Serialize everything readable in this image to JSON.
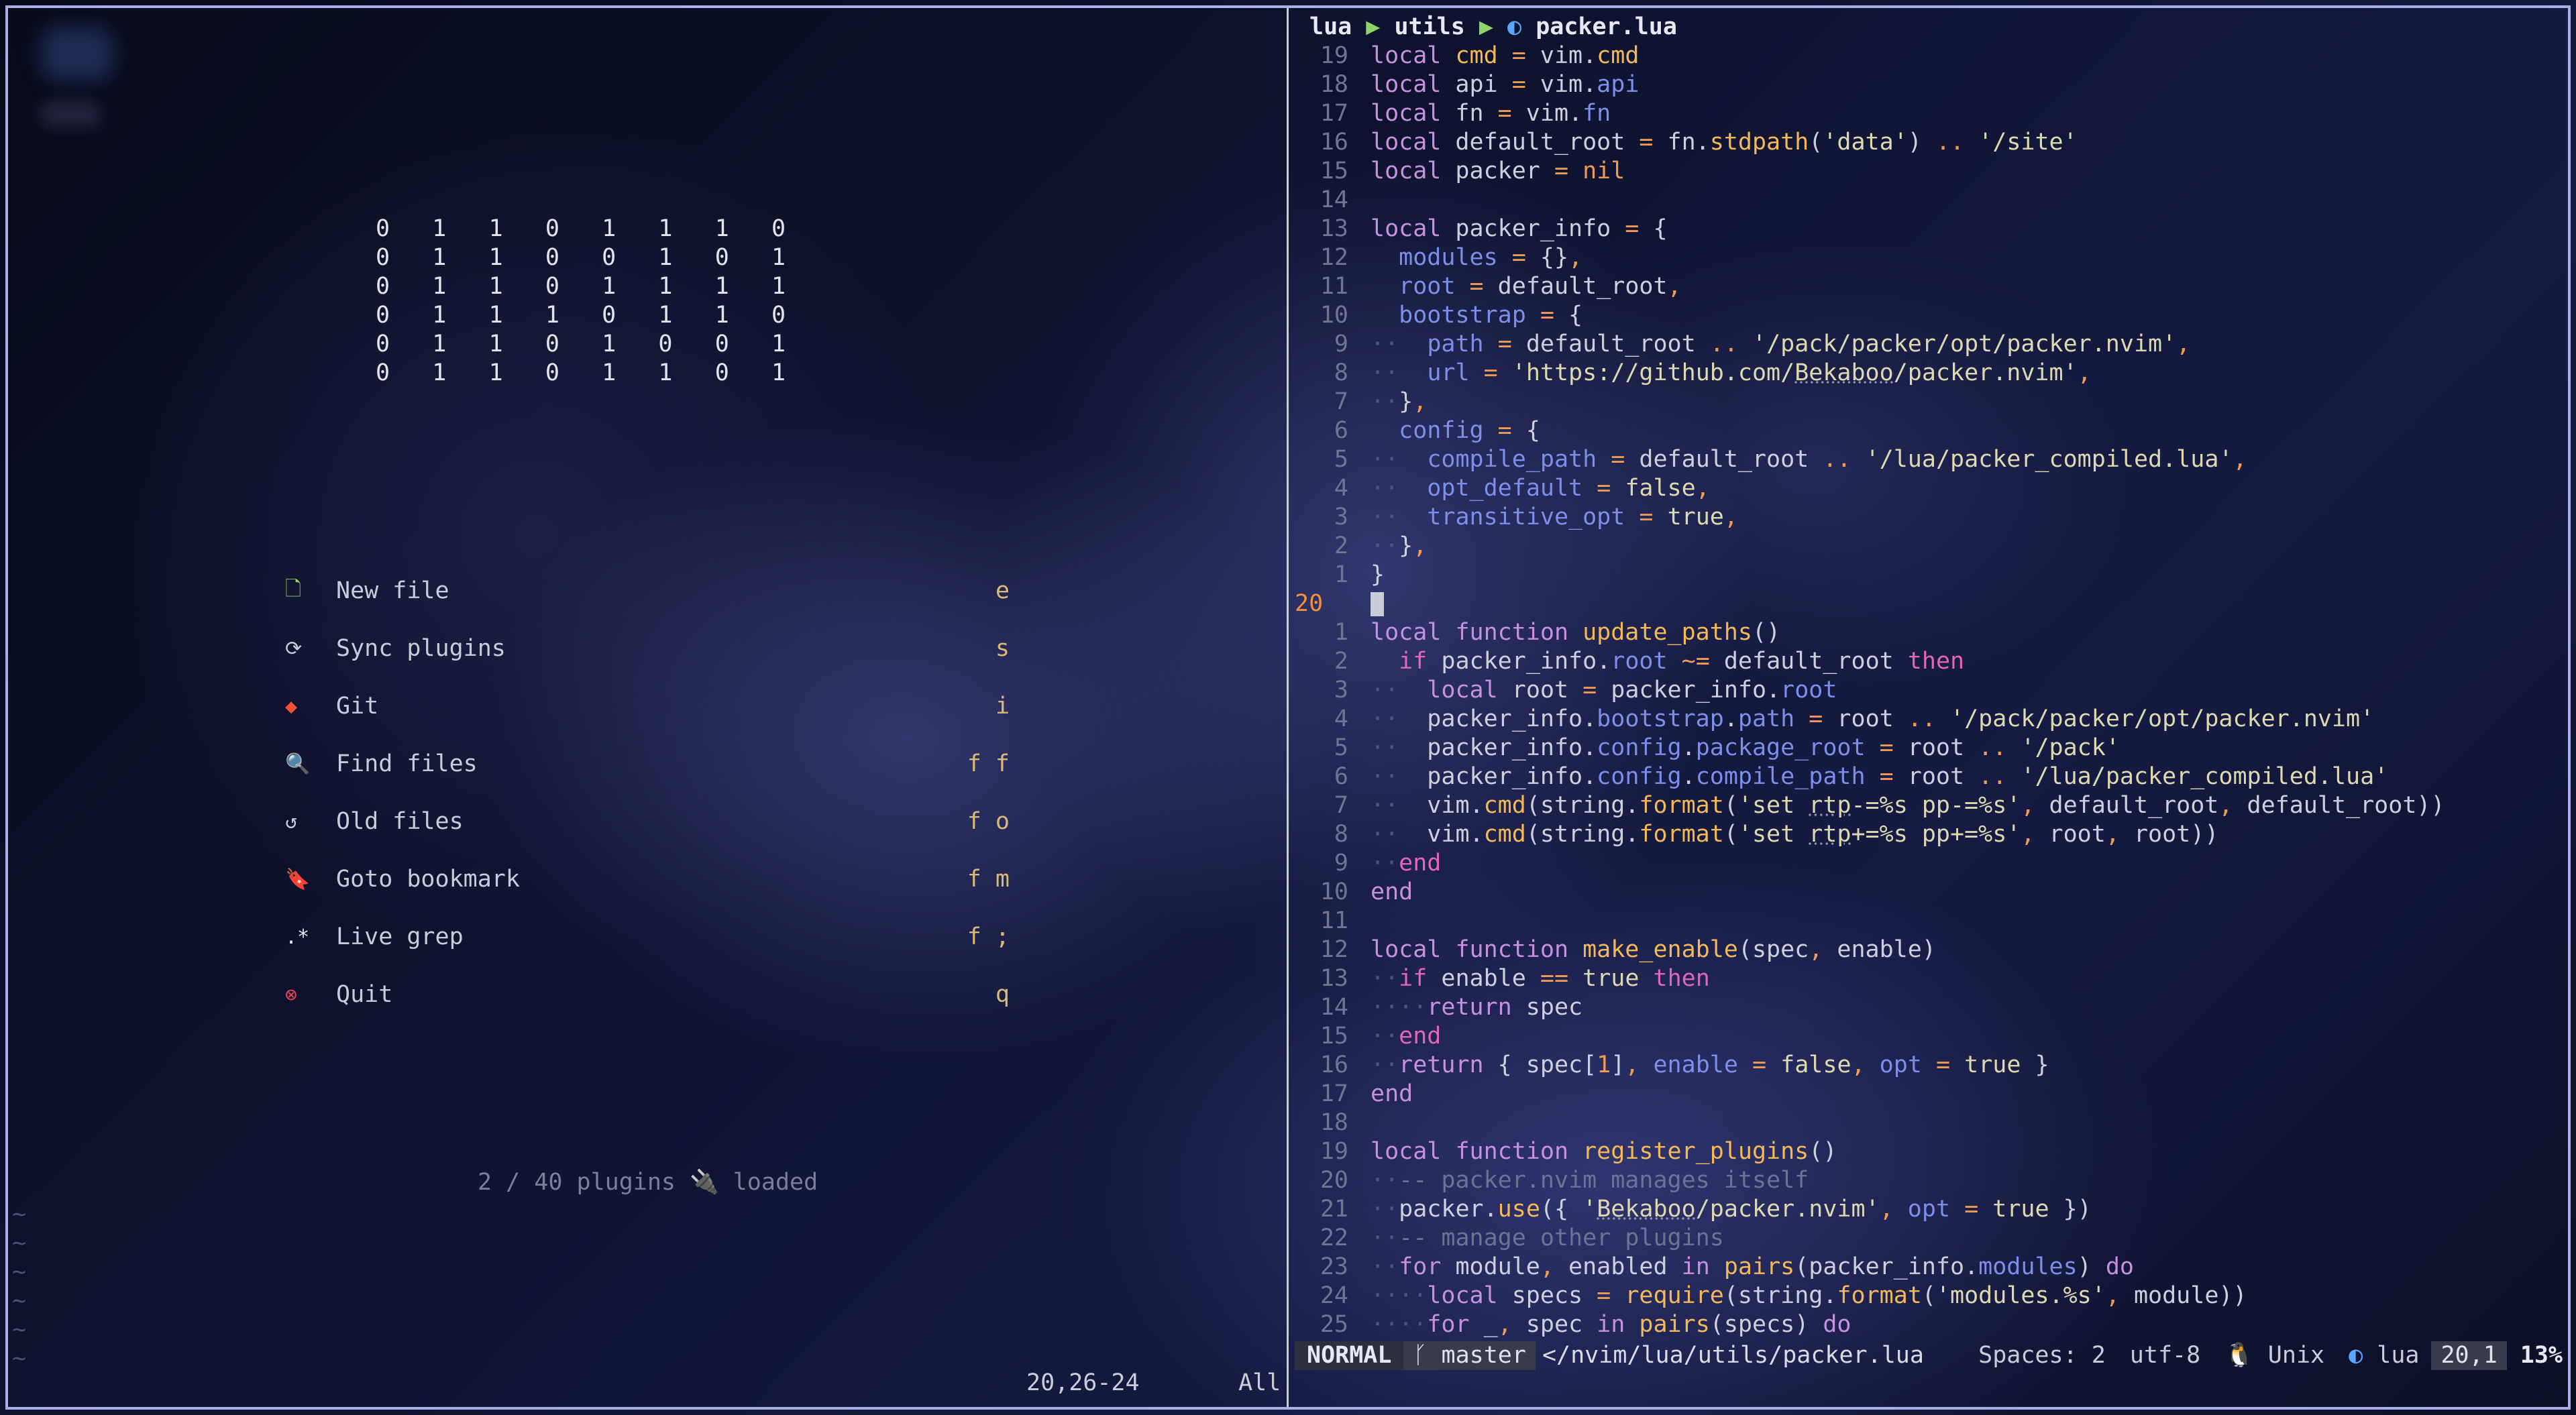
{
  "dashboard": {
    "binary_rows": [
      "0   1   1   0   1   1   1   0",
      "0   1   1   0   0   1   0   1",
      "0   1   1   0   1   1   1   1",
      "0   1   1   1   0   1   1   0",
      "0   1   1   0   1   0   0   1",
      "0   1   1   0   1   1   0   1"
    ],
    "menu": [
      {
        "icon": "new-file-icon",
        "glyph": "🗋",
        "color": "#9ad06a",
        "label": "New file",
        "key": "e"
      },
      {
        "icon": "sync-icon",
        "glyph": "⟳",
        "color": "#c8ccd8",
        "label": "Sync plugins",
        "key": "s"
      },
      {
        "icon": "git-icon",
        "glyph": "◆",
        "color": "#f05133",
        "label": "Git",
        "key": "i"
      },
      {
        "icon": "find-files-icon",
        "glyph": "🔍",
        "color": "#7fb2e8",
        "label": "Find files",
        "key": "f f"
      },
      {
        "icon": "history-icon",
        "glyph": "↺",
        "color": "#c8ccd8",
        "label": "Old files",
        "key": "f o"
      },
      {
        "icon": "bookmark-icon",
        "glyph": "🔖",
        "color": "#f2b85a",
        "label": "Goto bookmark",
        "key": "f m"
      },
      {
        "icon": "regex-icon",
        "glyph": ".*",
        "color": "#e8e8f2",
        "label": "Live grep",
        "key": "f ;"
      },
      {
        "icon": "quit-icon",
        "glyph": "⊗",
        "color": "#e0445a",
        "label": "Quit",
        "key": "q"
      }
    ],
    "plugins_loaded": "2 / 40  plugins 🔌 loaded",
    "tildes": "~\n~\n~\n~\n~\n~",
    "ruler": "20,26-24       All"
  },
  "winbar": {
    "dir1": "lua",
    "dir2": "utils",
    "file": "packer.lua",
    "sep": "▶",
    "file_icon": "lua-icon"
  },
  "code_lines": [
    {
      "n": "19",
      "h": "<span class='kw'>local</span> <span class='fn'>cmd</span> <span class='op'>=</span> vim.<span class='fn'>cmd</span>"
    },
    {
      "n": "18",
      "h": "<span class='kw'>local</span> api <span class='op'>=</span> vim.<span class='var'>api</span>"
    },
    {
      "n": "17",
      "h": "<span class='kw'>local</span> fn <span class='op'>=</span> vim.<span class='var'>fn</span>"
    },
    {
      "n": "16",
      "h": "<span class='kw'>local</span> default_root <span class='op'>=</span> fn.<span class='fn'>stdpath</span>(<span class='str'>'data'</span>) <span class='op'>..</span> <span class='str'>'/site'</span>"
    },
    {
      "n": "15",
      "h": "<span class='kw'>local</span> packer <span class='op'>=</span> <span class='op'>nil</span>"
    },
    {
      "n": "14",
      "h": ""
    },
    {
      "n": "13",
      "h": "<span class='kw'>local</span> packer_info <span class='op'>=</span> {"
    },
    {
      "n": "12",
      "h": "  <span class='var'>modules</span> <span class='op'>=</span> {}<span class='op'>,</span>"
    },
    {
      "n": "11",
      "h": "  <span class='var'>root</span> <span class='op'>=</span> default_root<span class='op'>,</span>"
    },
    {
      "n": "10",
      "h": "  <span class='var'>bootstrap</span> <span class='op'>=</span> {"
    },
    {
      "n": "9",
      "h": "<span class='dot'>··</span>  <span class='var'>path</span> <span class='op'>=</span> default_root <span class='op'>..</span> <span class='str'>'/pack/packer/opt/packer.nvim'</span><span class='op'>,</span>"
    },
    {
      "n": "8",
      "h": "<span class='dot'>··</span>  <span class='var'>url</span> <span class='op'>=</span> <span class='str'>'https://github.com/<span class=\"ul\">Bekaboo</span>/packer.nvim'</span><span class='op'>,</span>"
    },
    {
      "n": "7",
      "h": "<span class='dot'>··</span>}<span class='op'>,</span>"
    },
    {
      "n": "6",
      "h": "  <span class='var'>config</span> <span class='op'>=</span> {"
    },
    {
      "n": "5",
      "h": "<span class='dot'>··</span>  <span class='var'>compile_path</span> <span class='op'>=</span> default_root <span class='op'>..</span> <span class='str'>'/lua/packer_compiled.lua'</span><span class='op'>,</span>"
    },
    {
      "n": "4",
      "h": "<span class='dot'>··</span>  <span class='var'>opt_default</span> <span class='op'>=</span> <span class='str'>false</span><span class='op'>,</span>"
    },
    {
      "n": "3",
      "h": "<span class='dot'>··</span>  <span class='var'>transitive_opt</span> <span class='op'>=</span> <span class='str'>true</span><span class='op'>,</span>"
    },
    {
      "n": "2",
      "h": "<span class='dot'>··</span>}<span class='op'>,</span>"
    },
    {
      "n": "1",
      "h": "}"
    },
    {
      "n": "20",
      "cur": true,
      "h": "<span class='cursor'></span>"
    },
    {
      "n": "1",
      "h": "<span class='kw'>local</span> <span class='kw'>function</span> <span class='fn'>update_paths</span>()"
    },
    {
      "n": "2",
      "h": "  <span class='kw2'>if</span> packer_info.<span class='var'>root</span> <span class='op'>~=</span> default_root <span class='kw2'>then</span>"
    },
    {
      "n": "3",
      "h": "<span class='dot'>··</span>  <span class='kw'>local</span> root <span class='op'>=</span> packer_info.<span class='var'>root</span>"
    },
    {
      "n": "4",
      "h": "<span class='dot'>··</span>  packer_info.<span class='var'>bootstrap</span>.<span class='var'>path</span> <span class='op'>=</span> root <span class='op'>..</span> <span class='str'>'/pack/packer/opt/packer.nvim'</span>"
    },
    {
      "n": "5",
      "h": "<span class='dot'>··</span>  packer_info.<span class='var'>config</span>.<span class='var'>package_root</span> <span class='op'>=</span> root <span class='op'>..</span> <span class='str'>'/pack'</span>"
    },
    {
      "n": "6",
      "h": "<span class='dot'>··</span>  packer_info.<span class='var'>config</span>.<span class='var'>compile_path</span> <span class='op'>=</span> root <span class='op'>..</span> <span class='str'>'/lua/packer_compiled.lua'</span>"
    },
    {
      "n": "7",
      "h": "<span class='dot'>··</span>  vim.<span class='fn'>cmd</span>(string.<span class='fn'>format</span>(<span class='str'>'set <span class=\"ul\">rtp</span>-=%s pp-=%s'</span><span class='op'>,</span> default_root<span class='op'>,</span> default_root))"
    },
    {
      "n": "8",
      "h": "<span class='dot'>··</span>  vim.<span class='fn'>cmd</span>(string.<span class='fn'>format</span>(<span class='str'>'set <span class=\"ul\">rtp</span>+=%s pp+=%s'</span><span class='op'>,</span> root<span class='op'>,</span> root))"
    },
    {
      "n": "9",
      "h": "<span class='dot'>··</span><span class='kw2'>end</span>"
    },
    {
      "n": "10",
      "h": "<span class='kw'>end</span>"
    },
    {
      "n": "11",
      "h": ""
    },
    {
      "n": "12",
      "h": "<span class='kw'>local</span> <span class='kw'>function</span> <span class='fn'>make_enable</span>(spec<span class='op'>,</span> enable)"
    },
    {
      "n": "13",
      "h": "<span class='dot'>··</span><span class='kw2'>if</span> enable <span class='op'>==</span> <span class='str'>true</span> <span class='kw2'>then</span>"
    },
    {
      "n": "14",
      "h": "<span class='dot'>····</span><span class='kw'>return</span> spec"
    },
    {
      "n": "15",
      "h": "<span class='dot'>··</span><span class='kw2'>end</span>"
    },
    {
      "n": "16",
      "h": "<span class='dot'>··</span><span class='kw'>return</span> { spec[<span class='op'>1</span>]<span class='op'>,</span> <span class='var'>enable</span> <span class='op'>=</span> <span class='str'>false</span><span class='op'>,</span> <span class='var'>opt</span> <span class='op'>=</span> <span class='str'>true</span> }"
    },
    {
      "n": "17",
      "h": "<span class='kw'>end</span>"
    },
    {
      "n": "18",
      "h": ""
    },
    {
      "n": "19",
      "h": "<span class='kw'>local</span> <span class='kw'>function</span> <span class='fn'>register_plugins</span>()"
    },
    {
      "n": "20",
      "h": "<span class='dot'>··</span><span class='cmt'>-- packer.nvim manages itself</span>"
    },
    {
      "n": "21",
      "h": "<span class='dot'>··</span>packer.<span class='fn'>use</span>({ <span class='str'>'<span class=\"ul\">Bekaboo</span>/packer.nvim'</span><span class='op'>,</span> <span class='var'>opt</span> <span class='op'>=</span> <span class='str'>true</span> })"
    },
    {
      "n": "22",
      "h": "<span class='dot'>··</span><span class='cmt'>-- manage other plugins</span>"
    },
    {
      "n": "23",
      "h": "<span class='dot'>··</span><span class='kw'>for</span> module<span class='op'>,</span> enabled <span class='kw'>in</span> <span class='fn'>pairs</span>(packer_info.<span class='var'>modules</span>) <span class='kw'>do</span>"
    },
    {
      "n": "24",
      "h": "<span class='dot'>····</span><span class='kw'>local</span> specs <span class='op'>=</span> <span class='fn'>require</span>(string.<span class='fn'>format</span>(<span class='str'>'modules.%s'</span><span class='op'>,</span> module))"
    },
    {
      "n": "25",
      "h": "<span class='dot'>····</span><span class='kw'>for</span> _<span class='op'>,</span> spec <span class='kw'>in</span> <span class='fn'>pairs</span>(specs) <span class='kw'>do</span>"
    }
  ],
  "status": {
    "mode": "NORMAL",
    "branch": " master",
    "file": "</nvim/lua/utils/packer.lua",
    "spaces": "Spaces: 2",
    "encoding": "utf-8",
    "format": "🐧 Unix",
    "filetype": "lua",
    "position": "20,1",
    "percent": "13%"
  }
}
